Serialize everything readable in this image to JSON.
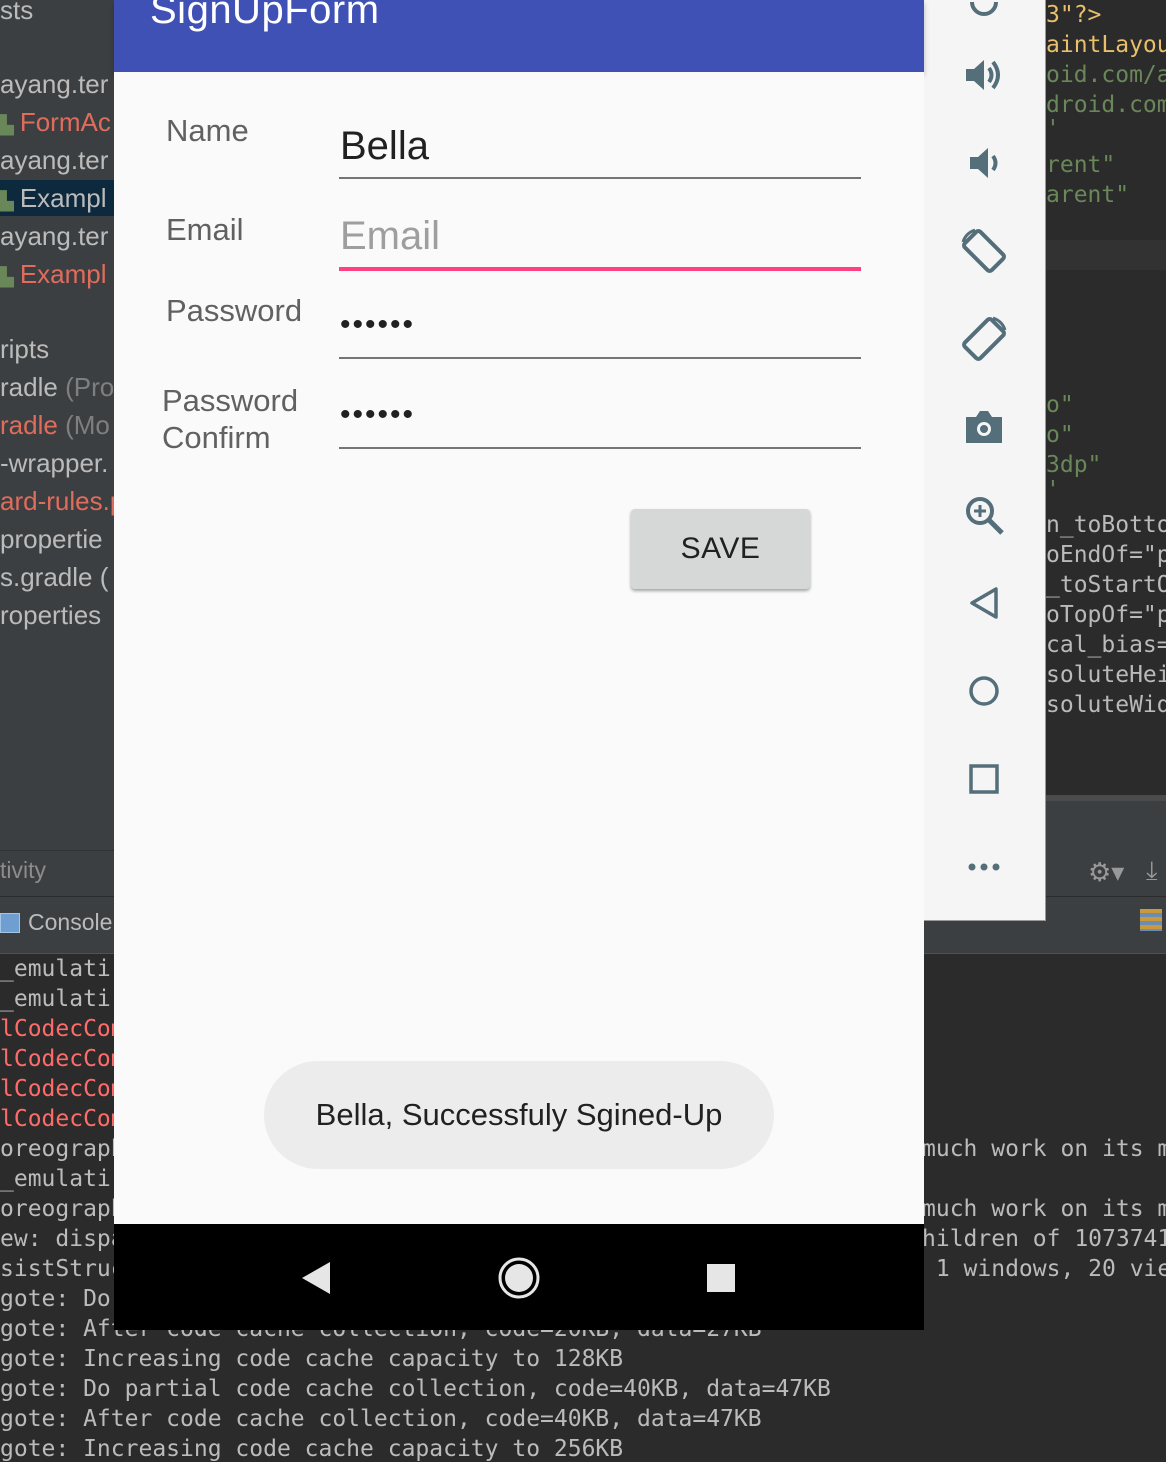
{
  "app": {
    "title": "SignUpForm",
    "fields": {
      "name_label": "Name",
      "name_value": "Bella",
      "email_label": "Email",
      "email_placeholder": "Email",
      "password_label": "Password",
      "password_value": "••••••",
      "password_confirm_label_line1": "Password",
      "password_confirm_label_line2": "Confirm",
      "password_confirm_value": "••••••"
    },
    "save_label": "SAVE",
    "toast": "Bella, Successfuly Sgined-Up"
  },
  "ide": {
    "project_lines": [
      {
        "text": "sts"
      },
      {
        "text": "ayang.ter"
      },
      {
        "text": "FormAc"
      },
      {
        "text": "ayang.ter"
      },
      {
        "text": "Exampl"
      },
      {
        "text": "ayang.ter"
      },
      {
        "text": "Exampl"
      },
      {
        "text": "ripts"
      },
      {
        "text": "radle",
        "suffix": "(Pro"
      },
      {
        "text": "radle",
        "suffix": "(Mo"
      },
      {
        "text": "-wrapper."
      },
      {
        "text": "ard-rules.p"
      },
      {
        "text": "propertie"
      },
      {
        "text": "s.gradle ("
      },
      {
        "text": "roperties"
      }
    ],
    "bottom_tab": "tivity",
    "console_tab": "Console",
    "code_lines": [
      "3\"?>",
      "aintLayou",
      "oid.com/a",
      "droid.com",
      "'",
      "rent\"",
      "arent\"",
      "o\"",
      "o\"",
      "3dp\"",
      "'",
      "n_toBotto",
      "oEndOf=\"p",
      "_toStartO",
      "oTopOf=\"p",
      "cal_bias=",
      "soluteHei",
      "soluteWid"
    ],
    "console_left": [
      "_emulati",
      "_emulati",
      "lCodecCom",
      "lCodecCom",
      "lCodecCom",
      "lCodecCom",
      "oreograph",
      "_emulati",
      "oreograph",
      "ew: dispa",
      "sistStruc",
      "gote: Do",
      "gote: After code cache collection, code=20KB, data=27KB",
      "gote: Increasing code cache capacity to 128KB",
      "gote: Do partial code cache collection, code=40KB, data=47KB",
      "gote: After code cache collection, code=40KB, data=47KB",
      "gote: Increasing code cache capacity to 256KB"
    ],
    "console_right": [
      "much work on its m",
      "much work on its m",
      "hildren of 1073741",
      " 1 windows, 20 vie"
    ]
  },
  "emulator_controls": [
    "power-icon",
    "volume-up-icon",
    "volume-down-icon",
    "rotate-left-icon",
    "rotate-right-icon",
    "camera-icon",
    "zoom-icon",
    "back-icon",
    "home-icon",
    "overview-icon",
    "more-icon"
  ],
  "colors": {
    "primary": "#3f51b5",
    "accent": "#ff4081",
    "ide_bg": "#2b2b2b",
    "ide_panel": "#3c3f41"
  }
}
